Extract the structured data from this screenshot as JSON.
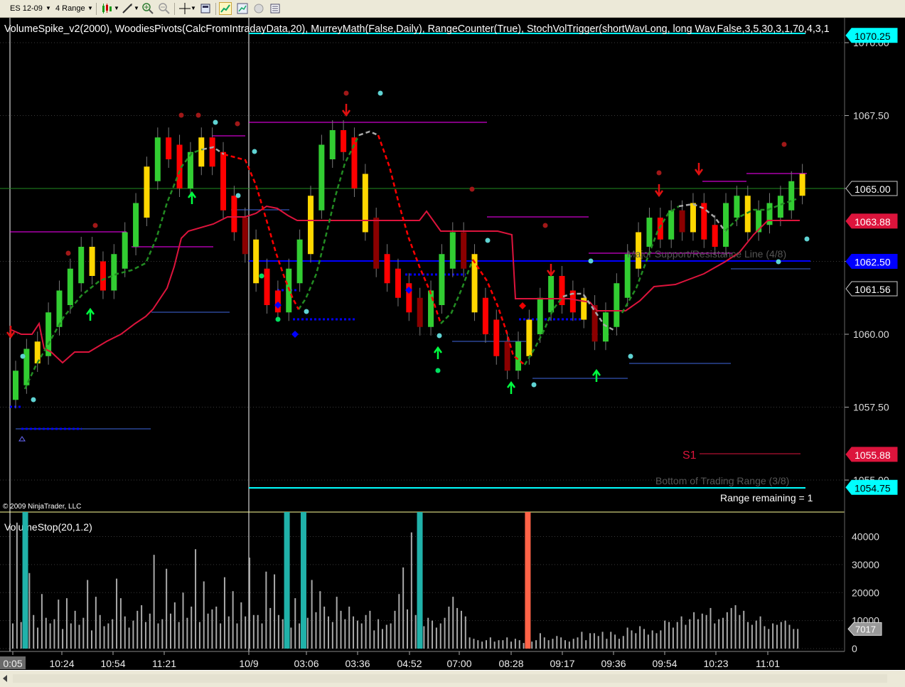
{
  "toolbar": {
    "instrument": "ES 12-09",
    "period": "4 Range"
  },
  "indicator_line": "VolumeSpike_v2(2000),  WoodiesPivots(CalcFromIntradayData,20),  MurreyMath(False,Daily),  RangeCounter(True),  StochVolTrigger(shortWavLong, long Wav,False,3,5,30,3,1,70,4,3,1",
  "copyright": "© 2009 NinjaTrader, LLC",
  "volume_title": "VolumeStop(20,1.2)",
  "range_remaining": "Range remaining = 1",
  "colors": {
    "up_bar": "#32cd32",
    "down_bar": "#ff0000",
    "yellow_bar": "#ffd700",
    "dark_down": "#8b0000",
    "cyan": "#00ffff",
    "blue": "#0000ff",
    "magenta": "#ff00ff",
    "crimson": "#dc143c",
    "volume": "#a9a9a9",
    "volume_cyan": "#20b2aa",
    "volume_orange": "#ff6347"
  },
  "chart_data": [
    {
      "type": "candlestick",
      "title": "ES 12-09 4 Range",
      "ylim": [
        1054.25,
        1070.75
      ],
      "y_ticks": [
        "1070.00",
        "1067.50",
        "1065.00",
        "1062.50",
        "1060.00",
        "1057.50",
        "1055.00"
      ],
      "x_ticks": [
        "0:05",
        "10:24",
        "10:54",
        "11:21",
        "10/9",
        "03:06",
        "03:36",
        "04:52",
        "07:00",
        "08:28",
        "09:17",
        "09:36",
        "09:54",
        "10:23",
        "11:01"
      ],
      "session_close": [
        1058.5,
        1059.25,
        1059.5,
        1060.5,
        1061.25,
        1062.0,
        1062.75,
        1062.25,
        1061.75,
        1062.5,
        1063.25,
        1064.25,
        1065.5,
        1066.5,
        1066.25,
        1065.25,
        1066.0,
        1066.5,
        1066.0,
        1064.5,
        1063.75,
        1063.0,
        1062.0,
        1061.25,
        1061.0,
        1062.0,
        1063.0,
        1064.5,
        1066.25,
        1066.75,
        1066.5,
        1065.25,
        1063.75,
        1062.5,
        1062.0,
        1061.5,
        1061.0,
        1060.5,
        1061.25,
        1062.5,
        1063.25,
        1062.5,
        1061.0,
        1060.25,
        1059.5,
        1059.0,
        1059.5,
        1060.25,
        1061.0,
        1061.75,
        1061.25,
        1061.0,
        1060.75,
        1060.0,
        1060.5,
        1061.5,
        1062.5,
        1063.25,
        1063.75,
        1063.5,
        1064.0,
        1063.75,
        1064.25,
        1063.5,
        1063.25,
        1064.25,
        1064.5,
        1063.75,
        1064.0,
        1064.25,
        1064.5,
        1065.0,
        1065.25
      ],
      "annotations": {
        "price_flags": [
          {
            "text": "1070.25",
            "price": 1070.25,
            "color": "cyan"
          },
          {
            "text": "1065.00",
            "price": 1065.0,
            "color": "black"
          },
          {
            "text": "1063.88",
            "price": 1063.88,
            "color": "crimson"
          },
          {
            "text": "1062.50",
            "price": 1062.5,
            "color": "blue"
          },
          {
            "text": "1061.56",
            "price": 1061.56,
            "color": "black"
          },
          {
            "text": "1055.88",
            "price": 1055.88,
            "color": "crimson"
          },
          {
            "text": "1054.75",
            "price": 1054.75,
            "color": "cyan"
          }
        ],
        "lines": [
          {
            "label": "Major Support/Resistance Line (4/8)",
            "price": 1062.5
          },
          {
            "label": "Bottom of Trading Range (3/8)",
            "price": 1054.75
          },
          {
            "label": "S1",
            "price": 1055.88
          }
        ]
      }
    },
    {
      "type": "bar",
      "title": "VolumeStop(20,1.2)",
      "ylim": [
        0,
        47500
      ],
      "y_ticks": [
        "40000",
        "30000",
        "20000",
        "10000",
        "0"
      ],
      "last_value": "7017",
      "volume_series": [
        9000,
        45000,
        9500,
        6500,
        27000,
        12000,
        7500,
        19500,
        11000,
        9000,
        10500,
        17500,
        7000,
        18000,
        9000,
        13500,
        8500,
        11000,
        24500,
        6500,
        18500,
        12000,
        8000,
        9000,
        10500,
        25000,
        18000,
        11500,
        7500,
        10000,
        13500,
        15500,
        9500,
        12500,
        33500,
        9000,
        10500,
        28500,
        12500,
        16500,
        9500,
        20000,
        11000,
        15000,
        35500,
        9500,
        24000,
        12500,
        14000,
        15000,
        9000,
        25500,
        11500,
        20500,
        9000,
        16500,
        11500,
        32500,
        12000,
        12000,
        9000,
        27500,
        14500,
        26500,
        12000,
        10500,
        15500,
        7500,
        18000,
        9000,
        20500,
        11000,
        24500,
        13000,
        20500,
        15000,
        11500,
        9500,
        18500,
        13500,
        10500,
        15000,
        11500,
        10000,
        9000,
        12000,
        13500,
        6500,
        10500,
        7000,
        8500,
        9000,
        13500,
        19500,
        29000,
        14000,
        41500,
        12000,
        18000,
        8000,
        11000,
        10000,
        7500,
        9000,
        11000,
        15000,
        18500,
        14500,
        13500,
        11500,
        4000,
        3500,
        3000,
        2500,
        3000,
        4000,
        2500,
        3000,
        3000,
        4000,
        2500,
        3500,
        3000,
        2000,
        4500,
        2500,
        3000,
        5500,
        4000,
        3000,
        3500,
        4500,
        4000,
        3000,
        2500,
        3500,
        4000,
        6000,
        3000,
        5500,
        5500,
        4500,
        6000,
        3500,
        6000,
        5000,
        3500,
        4500,
        7500,
        6500,
        5500,
        8000,
        7000,
        5000,
        6500,
        5500,
        6500,
        10000,
        9500,
        7500,
        9500,
        11500,
        8500,
        10500,
        13000,
        10500,
        12500,
        12000,
        14500,
        9000,
        10500,
        11000,
        13000,
        14500,
        15500,
        12000,
        13500,
        9500,
        8500,
        10000,
        11500,
        8000,
        7000,
        9000,
        8500,
        9500,
        10000,
        8500,
        7000,
        7017
      ],
      "highlight_bars": [
        {
          "index": 3,
          "color": "cyan"
        },
        {
          "index": 66,
          "color": "cyan"
        },
        {
          "index": 70,
          "color": "cyan"
        },
        {
          "index": 98,
          "color": "cyan"
        },
        {
          "index": 124,
          "color": "orange"
        }
      ]
    }
  ]
}
